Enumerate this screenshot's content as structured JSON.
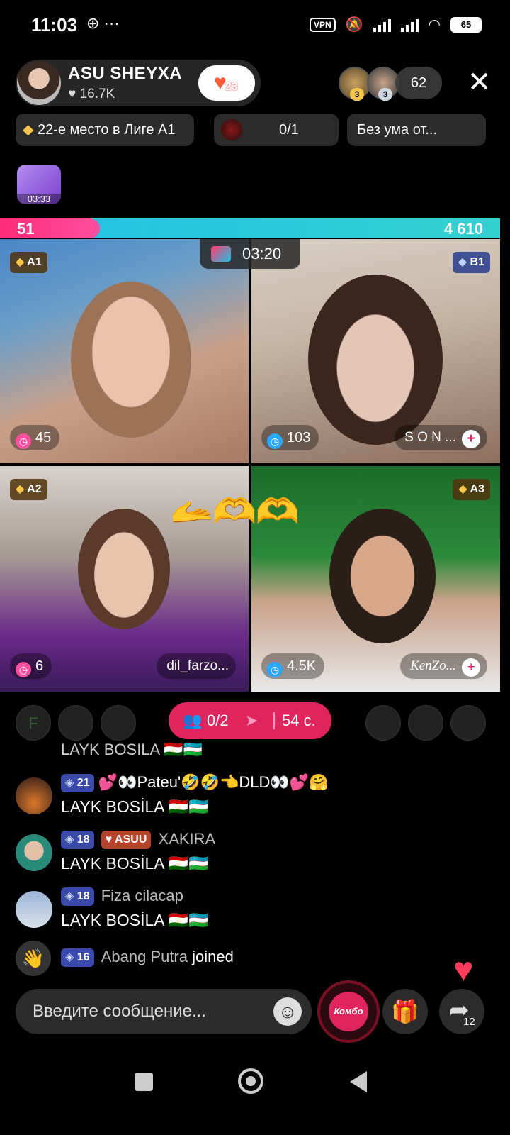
{
  "status_bar": {
    "time": "11:03",
    "left_icons": "⊕ ···",
    "vpn": "VPN",
    "battery": "65"
  },
  "host": {
    "name": "ASU SHEYXA",
    "likes": "16.7K",
    "follow_badge": "23"
  },
  "viewers": {
    "avatar1_badge": "3",
    "avatar2_badge": "3",
    "count": "62"
  },
  "chips": {
    "league": "22-е место в Лиге A1",
    "progress": "0/1",
    "promo": "Без ума от..."
  },
  "sticker": {
    "time": "03:33"
  },
  "battle": {
    "left_score": "51",
    "right_score": "4 610",
    "left_fraction": 0.2,
    "timer": "03:20"
  },
  "tiles": [
    {
      "rank": "A1",
      "score": "45",
      "name": ""
    },
    {
      "rank": "B1",
      "score": "103",
      "name": "S O N ..."
    },
    {
      "rank": "A2",
      "score": "6",
      "name": "dil_farzo..."
    },
    {
      "rank": "A3",
      "score": "4.5K",
      "name": "KenZo..."
    }
  ],
  "guests": {
    "left_letter": "F",
    "cohost_count": "0/2",
    "cohost_time": "54 с."
  },
  "chat": {
    "cut_message": "LAYK BOSILA 🇹🇯🇺🇿",
    "messages": [
      {
        "level": "21",
        "fan": "",
        "user": "💕👀Pateu'🤣🤣👈DLD👀💕🤗",
        "text": "LAYK BOSİLA 🇹🇯🇺🇿"
      },
      {
        "level": "18",
        "fan": "ASUU",
        "user": "XAKIRA",
        "text": "LAYK BOSİLA 🇹🇯🇺🇿"
      },
      {
        "level": "18",
        "fan": "",
        "user": "Fiza cilacap",
        "text": "LAYK BOSİLA 🇹🇯🇺🇿"
      }
    ],
    "joined": {
      "level": "16",
      "user": "Abang Putra",
      "text": "joined"
    }
  },
  "input": {
    "placeholder": "Введите сообщение...",
    "combo_label": "Комбо",
    "share_count": "12"
  },
  "icons": {
    "heart": "heart-icon",
    "gift": "gift-icon",
    "share": "share-icon",
    "close": "close-icon",
    "emoji": "emoji-icon",
    "wave": "wave-icon"
  },
  "colors": {
    "accent_pink": "#e0245e",
    "battle_blue": "#21c1e8",
    "gold": "#f7c64a"
  }
}
